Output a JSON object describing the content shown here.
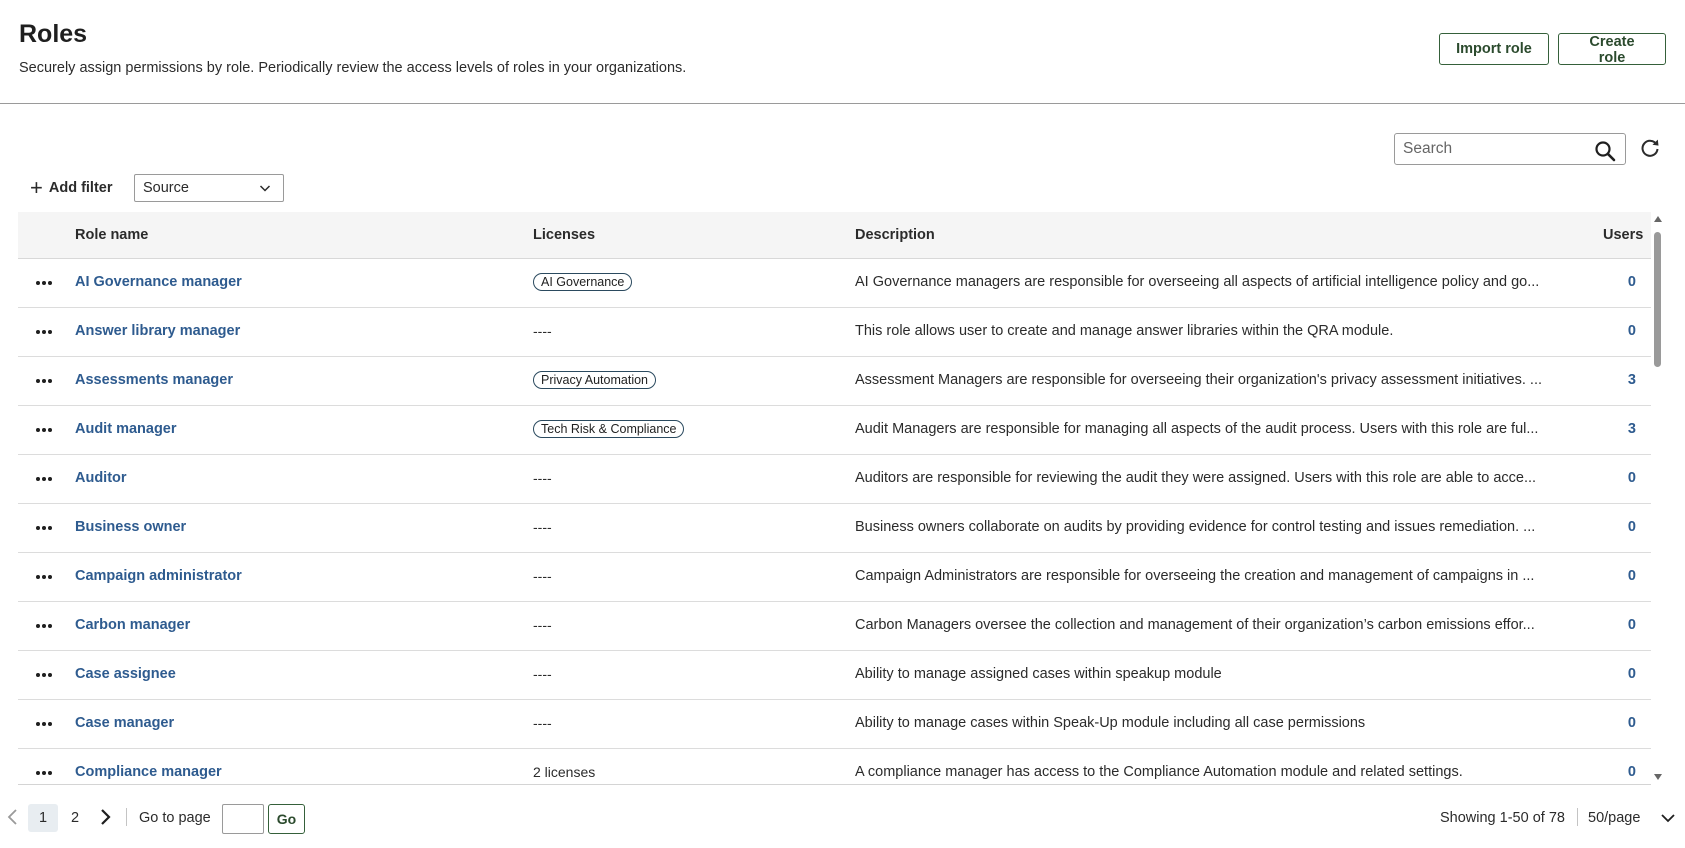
{
  "header": {
    "title": "Roles",
    "subtitle": "Securely assign permissions by role. Periodically review the access levels of roles in your organizations.",
    "import_label": "Import role",
    "create_label": "Create role"
  },
  "toolbar": {
    "search_placeholder": "Search",
    "add_filter_label": "Add filter",
    "source_select_value": "Source"
  },
  "table": {
    "columns": {
      "name": "Role name",
      "licenses": "Licenses",
      "description": "Description",
      "users": "Users"
    },
    "rows": [
      {
        "name": "AI Governance manager",
        "license": "AI Governance",
        "license_is_tag": true,
        "description": "AI Governance managers are responsible for overseeing all aspects of artificial intelligence policy and go...",
        "users": "0"
      },
      {
        "name": "Answer library manager",
        "license": "----",
        "license_is_tag": false,
        "description": "This role allows user to create and manage answer libraries within the QRA module.",
        "users": "0"
      },
      {
        "name": "Assessments manager",
        "license": "Privacy Automation",
        "license_is_tag": true,
        "description": "Assessment Managers are responsible for overseeing their organization's privacy assessment initiatives. ...",
        "users": "3"
      },
      {
        "name": "Audit manager",
        "license": "Tech Risk & Compliance",
        "license_is_tag": true,
        "description": "Audit Managers are responsible for managing all aspects of the audit process. Users with this role are ful...",
        "users": "3"
      },
      {
        "name": "Auditor",
        "license": "----",
        "license_is_tag": false,
        "description": "Auditors are responsible for reviewing the audit they were assigned. Users with this role are able to acce...",
        "users": "0"
      },
      {
        "name": "Business owner",
        "license": "----",
        "license_is_tag": false,
        "description": "Business owners collaborate on audits by providing evidence for control testing and issues remediation. ...",
        "users": "0"
      },
      {
        "name": "Campaign administrator",
        "license": "----",
        "license_is_tag": false,
        "description": "Campaign Administrators are responsible for overseeing the creation and management of campaigns in ...",
        "users": "0"
      },
      {
        "name": "Carbon manager",
        "license": "----",
        "license_is_tag": false,
        "description": "Carbon Managers oversee the collection and management of their organization’s carbon emissions effor...",
        "users": "0"
      },
      {
        "name": "Case assignee",
        "license": "----",
        "license_is_tag": false,
        "description": "Ability to manage assigned cases within speakup module",
        "users": "0"
      },
      {
        "name": "Case manager",
        "license": "----",
        "license_is_tag": false,
        "description": "Ability to manage cases within Speak-Up module including all case permissions",
        "users": "0"
      },
      {
        "name": "Compliance manager",
        "license": "2 licenses",
        "license_is_tag": false,
        "description": "A compliance manager has access to the Compliance Automation module and related settings.",
        "users": "0"
      }
    ]
  },
  "pagination": {
    "pages": [
      "1",
      "2"
    ],
    "current_page": "1",
    "goto_label": "Go to page",
    "go_label": "Go",
    "showing": "Showing 1-50 of 78",
    "per_page": "50/page"
  },
  "colors": {
    "link": "#2e5b8f",
    "button_border": "#35603a",
    "header_bg": "#f5f5f5"
  }
}
